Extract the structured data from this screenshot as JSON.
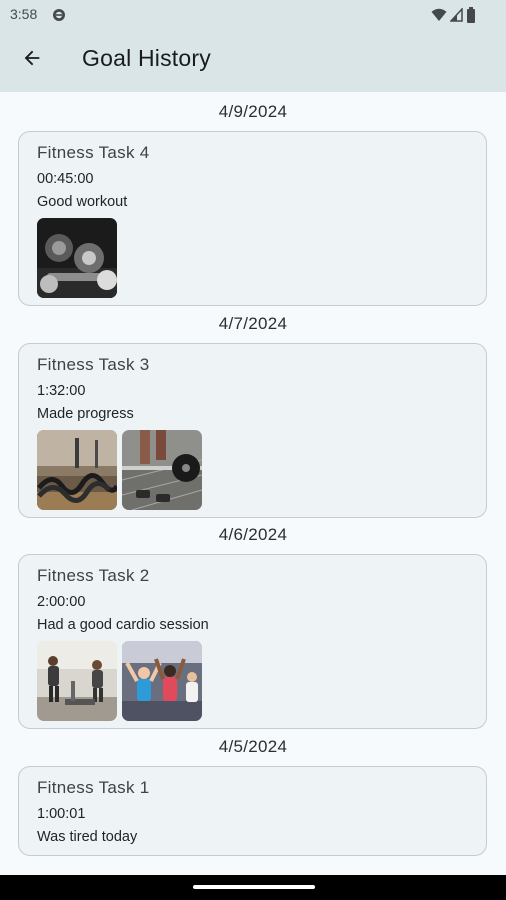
{
  "status_bar": {
    "time": "3:58",
    "icons": [
      "notification-dot-icon",
      "wifi-icon",
      "signal-icon",
      "battery-icon"
    ]
  },
  "app_bar": {
    "back_icon": "arrow-back-icon",
    "title": "Goal History"
  },
  "history": [
    {
      "date": "4/9/2024",
      "task": "Fitness Task 4",
      "duration": "00:45:00",
      "note": "Good workout",
      "photos": [
        "dumbbell-rack-photo"
      ]
    },
    {
      "date": "4/7/2024",
      "task": "Fitness Task 3",
      "duration": "1:32:00",
      "note": "Made progress",
      "photos": [
        "battle-ropes-photo",
        "barbell-deadlift-photo"
      ]
    },
    {
      "date": "4/6/2024",
      "task": "Fitness Task 2",
      "duration": "2:00:00",
      "note": "Had a good cardio session",
      "photos": [
        "treadmill-runners-photo",
        "group-fitness-class-photo"
      ]
    },
    {
      "date": "4/5/2024",
      "task": "Fitness Task 1",
      "duration": "1:00:01",
      "note": "Was tired today",
      "photos": []
    }
  ],
  "colors": {
    "app_bar_bg": "#dae5e7",
    "page_bg": "#f6fafc",
    "card_bg": "#eef3f5",
    "card_border": "#c4ccd0"
  }
}
